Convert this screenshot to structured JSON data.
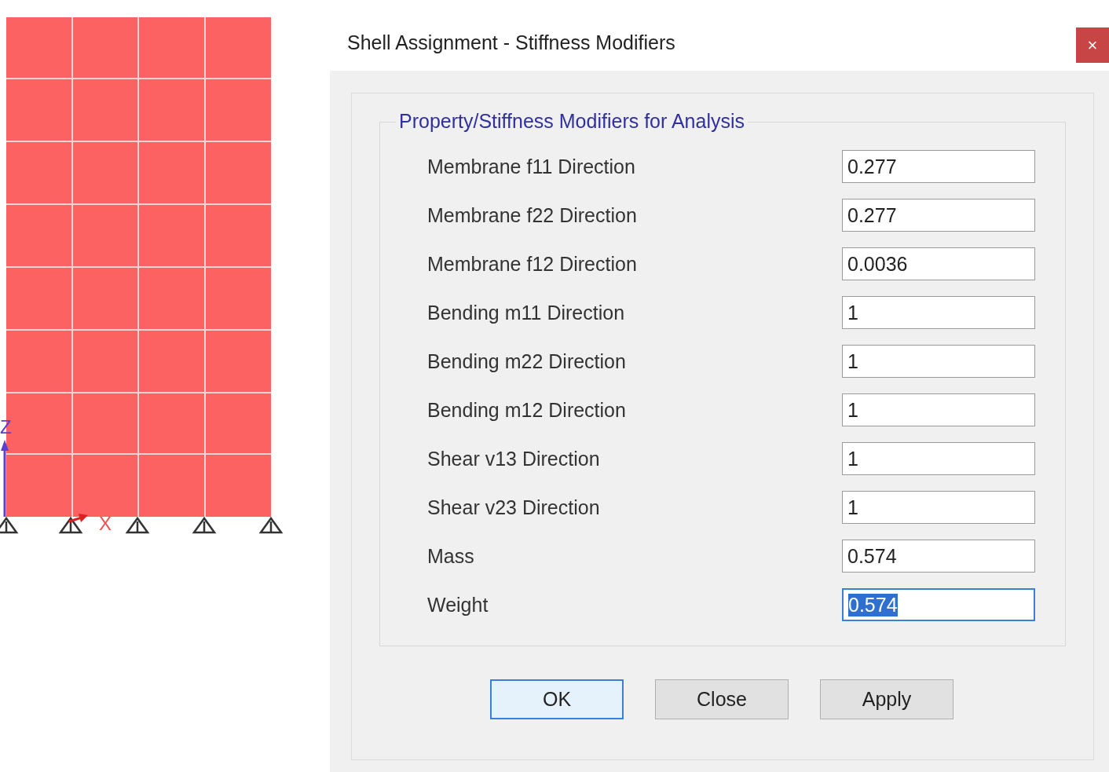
{
  "model": {
    "axes": [
      {
        "kind": "vertical",
        "label": "Z"
      },
      {
        "kind": "horizontal",
        "label": "X"
      }
    ]
  },
  "dialog": {
    "title": "Shell Assignment - Stiffness Modifiers",
    "close_button": "×",
    "group": {
      "title": "Property/Stiffness Modifiers for Analysis"
    },
    "fields": [
      {
        "label": "Membrane f11 Direction",
        "value": "0.277",
        "focused": false
      },
      {
        "label": "Membrane f22 Direction",
        "value": "0.277",
        "focused": false
      },
      {
        "label": "Membrane f12 Direction",
        "value": "0.0036",
        "focused": false
      },
      {
        "label": "Bending m11 Direction",
        "value": "1",
        "focused": false
      },
      {
        "label": "Bending m22 Direction",
        "value": "1",
        "focused": false
      },
      {
        "label": "Bending m12 Direction",
        "value": "1",
        "focused": false
      },
      {
        "label": "Shear v13 Direction",
        "value": "1",
        "focused": false
      },
      {
        "label": "Shear v23 Direction",
        "value": "1",
        "focused": false
      },
      {
        "label": "Mass",
        "value": "0.574",
        "focused": false
      },
      {
        "label": "Weight",
        "value": "0.574",
        "focused": true
      }
    ],
    "buttons": [
      {
        "label": "OK",
        "default": true
      },
      {
        "label": "Close",
        "default": false
      },
      {
        "label": "Apply",
        "default": false
      }
    ]
  }
}
